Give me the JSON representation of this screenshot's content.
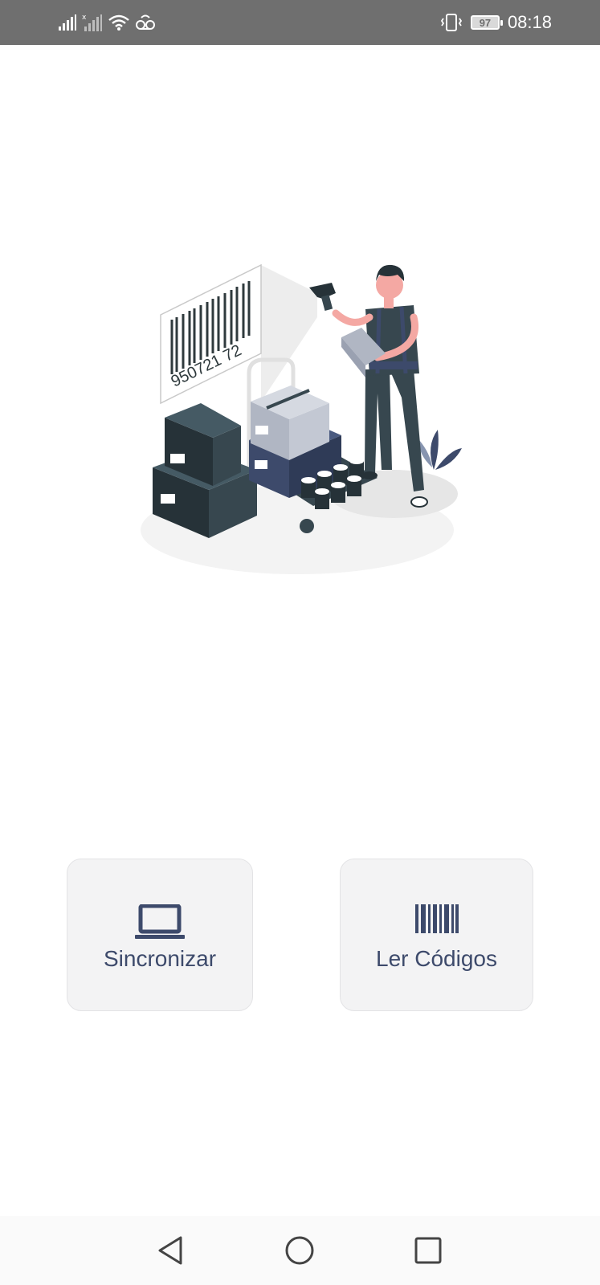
{
  "status_bar": {
    "time": "08:18",
    "battery_level": "97",
    "icons": [
      "signal-icon",
      "signal-no-sim-icon",
      "wifi-icon",
      "voicemail-icon",
      "vibrate-icon",
      "battery-icon"
    ]
  },
  "illustration": {
    "barcode_number": "950721 72",
    "icon": "warehouse-scanner-illustration"
  },
  "actions": {
    "sync": {
      "label": "Sincronizar",
      "icon": "laptop-icon"
    },
    "scan": {
      "label": "Ler Códigos",
      "icon": "barcode-icon"
    }
  },
  "nav": {
    "icons": [
      "back-icon",
      "home-icon",
      "recents-icon"
    ]
  },
  "colors": {
    "accent": "#3d4a6b",
    "status_bar": "#6f6f6f",
    "card_bg": "#f3f3f4"
  }
}
